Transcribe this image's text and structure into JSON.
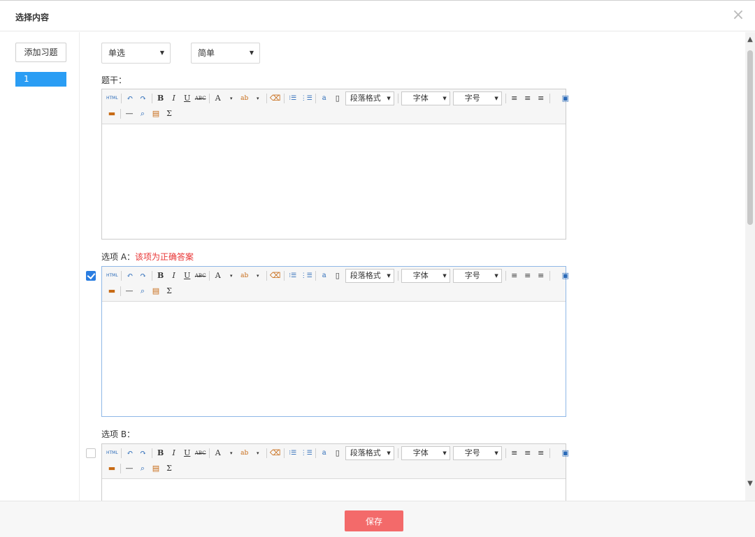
{
  "dialog": {
    "title": "选择内容",
    "close_icon": "×"
  },
  "left": {
    "add_label": "添加习题",
    "questions": [
      "1"
    ]
  },
  "selects": {
    "type_value": "单选",
    "difficulty_value": "简单",
    "caret": "▼"
  },
  "labels": {
    "stem": "题干：",
    "option_a": "选项 A：",
    "option_a_correct": "该项为正确答案",
    "option_b": "选项 B："
  },
  "toolbar": {
    "html": "HTML",
    "undo": "↶",
    "redo": "↷",
    "bold": "B",
    "italic": "I",
    "underline": "U",
    "strike": "ABC",
    "fontcolor": "A",
    "bgcolor": "ab",
    "eraser": "⌫",
    "ol": "⁝☰",
    "ul": "⋮☰",
    "anchor": "a",
    "page": "▯",
    "paragraph": "段落格式",
    "fontfamily": "字体",
    "fontsize": "字号",
    "align_left": "≡",
    "align_center": "≡",
    "align_right": "≡",
    "preview": "▣",
    "image": "▬",
    "hr": "—",
    "search": "⌕",
    "paste": "▤",
    "formula": "Σ",
    "dd": "▾"
  },
  "options": {
    "a_checked": true,
    "b_checked": false
  },
  "scroll": {
    "up": "▲",
    "down": "▼"
  },
  "footer": {
    "save_label": "保存"
  },
  "colors": {
    "accent": "#2a9df4",
    "save": "#f36a6a",
    "correct": "#e83434"
  }
}
